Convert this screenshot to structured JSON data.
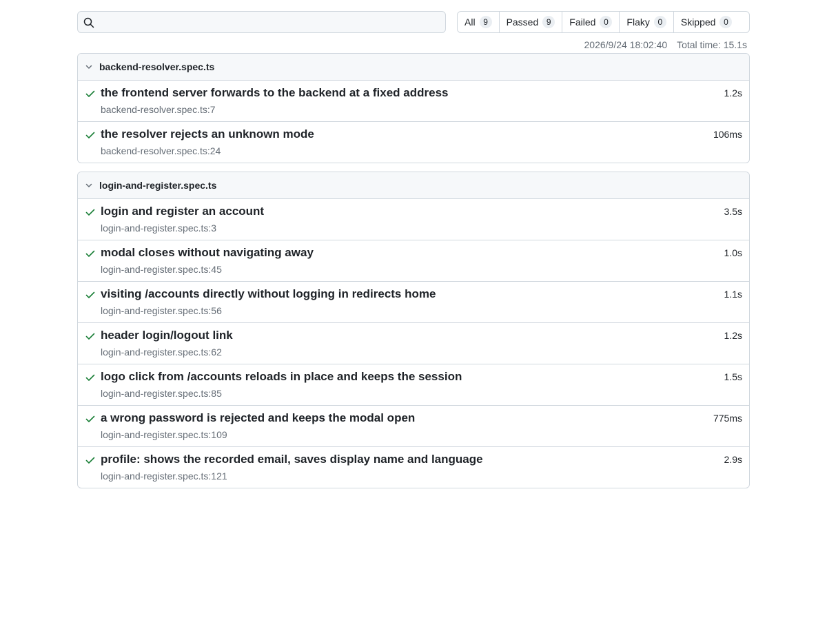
{
  "search": {
    "value": "",
    "placeholder": ""
  },
  "filters": [
    {
      "label": "All",
      "count": "9"
    },
    {
      "label": "Passed",
      "count": "9"
    },
    {
      "label": "Failed",
      "count": "0"
    },
    {
      "label": "Flaky",
      "count": "0"
    },
    {
      "label": "Skipped",
      "count": "0"
    }
  ],
  "meta": {
    "timestamp": "2026/9/24 18:02:40",
    "total_time": "Total time: 15.1s"
  },
  "files": [
    {
      "name": "backend-resolver.spec.ts",
      "tests": [
        {
          "title": "the frontend server forwards to the backend at a fixed address",
          "location": "backend-resolver.spec.ts:7",
          "duration": "1.2s",
          "status": "passed"
        },
        {
          "title": "the resolver rejects an unknown mode",
          "location": "backend-resolver.spec.ts:24",
          "duration": "106ms",
          "status": "passed"
        }
      ]
    },
    {
      "name": "login-and-register.spec.ts",
      "tests": [
        {
          "title": "login and register an account",
          "location": "login-and-register.spec.ts:3",
          "duration": "3.5s",
          "status": "passed"
        },
        {
          "title": "modal closes without navigating away",
          "location": "login-and-register.spec.ts:45",
          "duration": "1.0s",
          "status": "passed"
        },
        {
          "title": "visiting /accounts directly without logging in redirects home",
          "location": "login-and-register.spec.ts:56",
          "duration": "1.1s",
          "status": "passed"
        },
        {
          "title": "header login/logout link",
          "location": "login-and-register.spec.ts:62",
          "duration": "1.2s",
          "status": "passed"
        },
        {
          "title": "logo click from /accounts reloads in place and keeps the session",
          "location": "login-and-register.spec.ts:85",
          "duration": "1.5s",
          "status": "passed"
        },
        {
          "title": "a wrong password is rejected and keeps the modal open",
          "location": "login-and-register.spec.ts:109",
          "duration": "775ms",
          "status": "passed"
        },
        {
          "title": "profile: shows the recorded email, saves display name and language",
          "location": "login-and-register.spec.ts:121",
          "duration": "2.9s",
          "status": "passed"
        }
      ]
    }
  ],
  "colors": {
    "passed": "#1a7f37",
    "border": "#d0d7de",
    "header_bg": "#f6f8fa",
    "muted_text": "#656d76"
  },
  "icons": {
    "search": "search-icon",
    "expand": "chevron-down-icon",
    "status": "check-icon"
  }
}
